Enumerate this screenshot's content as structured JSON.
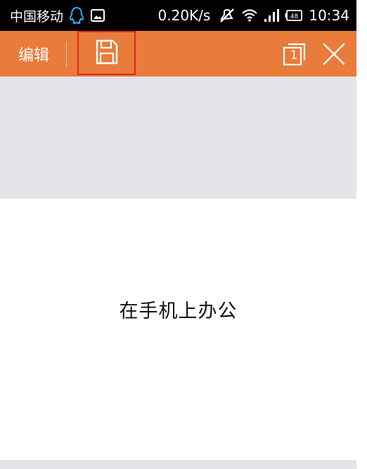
{
  "status_bar": {
    "carrier": "中国移动",
    "net_speed": "0.20K/s",
    "battery_level": "48",
    "time": "10:34",
    "icons": [
      "qq-icon",
      "image-notification-icon",
      "mute-icon",
      "wifi-icon",
      "signal-icon",
      "battery-icon"
    ]
  },
  "toolbar": {
    "edit_label": "编辑",
    "page_count": "1",
    "icons": [
      "save-icon",
      "page-count-icon",
      "close-icon"
    ],
    "colors": {
      "background": "#e97b3b",
      "highlight_border": "#e0261f"
    }
  },
  "document": {
    "content_text": "在手机上办公"
  }
}
